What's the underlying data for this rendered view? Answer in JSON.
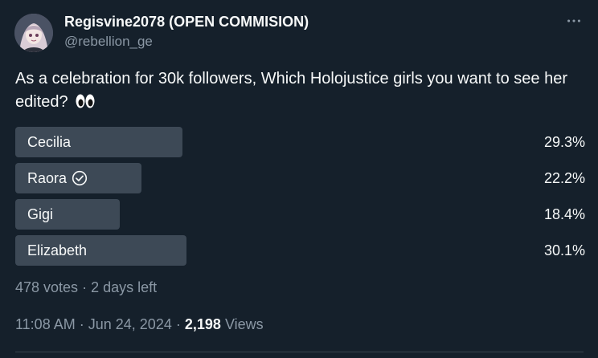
{
  "author": {
    "display_name": "Regisvine2078 (OPEN COMMISION)",
    "handle": "@rebellion_ge",
    "avatar_icon": "anime-avatar"
  },
  "tweet": {
    "text": "As a celebration for 30k followers, Which Holojustice girls you want to see her edited?",
    "emoji": "eyes-emoji"
  },
  "poll": {
    "options": [
      {
        "label": "Cecilia",
        "percent": "29.3%",
        "fraction": 0.293,
        "selected": false
      },
      {
        "label": "Raora",
        "percent": "22.2%",
        "fraction": 0.222,
        "selected": true
      },
      {
        "label": "Gigi",
        "percent": "18.4%",
        "fraction": 0.184,
        "selected": false
      },
      {
        "label": "Elizabeth",
        "percent": "30.1%",
        "fraction": 0.301,
        "selected": false
      }
    ],
    "votes": "478 votes",
    "separator": "·",
    "time_left": "2 days left"
  },
  "meta": {
    "time": "11:08 AM",
    "separator": "·",
    "date": "Jun 24, 2024",
    "views_count": "2,198",
    "views_label": "Views"
  },
  "colors": {
    "background": "#15202b",
    "bar": "#3d4956",
    "secondary_text": "#8b98a5"
  }
}
